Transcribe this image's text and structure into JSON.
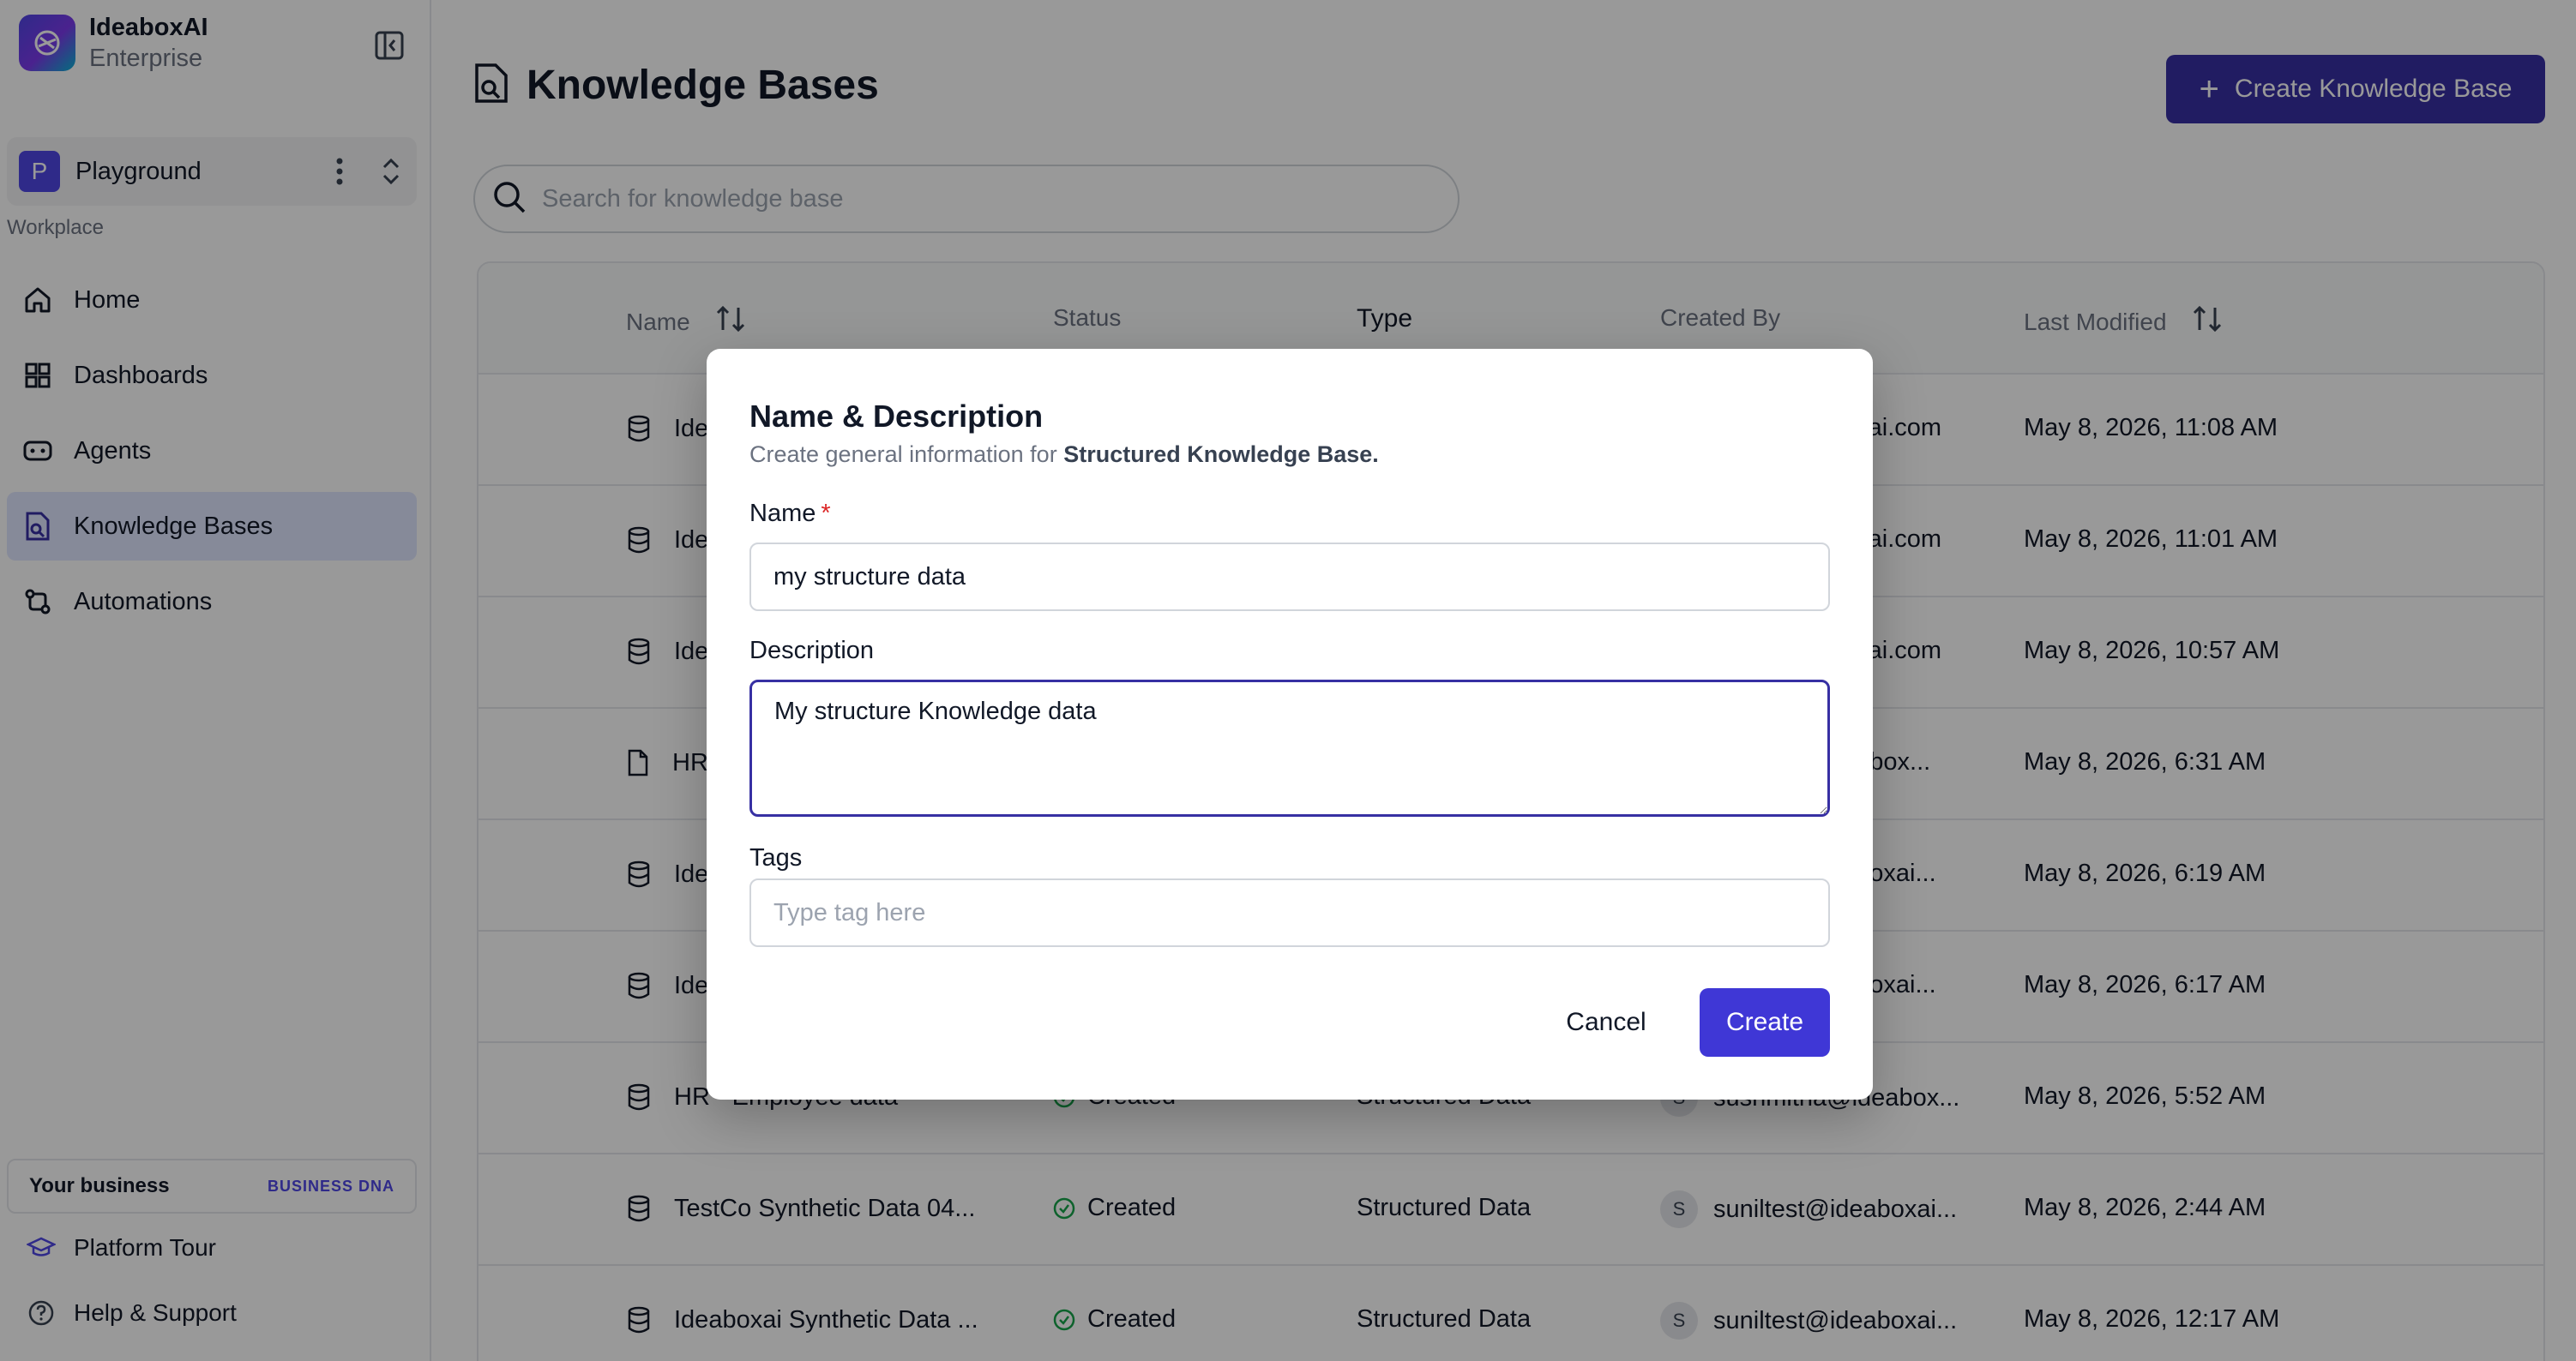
{
  "brand": {
    "name": "IdeaboxAI",
    "plan": "Enterprise"
  },
  "workspace": {
    "initial": "P",
    "name": "Playground",
    "label": "Workplace"
  },
  "nav": [
    {
      "label": "Home",
      "icon": "home-icon"
    },
    {
      "label": "Dashboards",
      "icon": "grid-icon"
    },
    {
      "label": "Agents",
      "icon": "agent-icon"
    },
    {
      "label": "Knowledge Bases",
      "icon": "knowledge-icon",
      "active": true
    },
    {
      "label": "Automations",
      "icon": "workflow-icon"
    }
  ],
  "business": {
    "title": "Your business",
    "tag": "BUSINESS DNA"
  },
  "footer": {
    "tour": "Platform Tour",
    "help": "Help & Support"
  },
  "page": {
    "title": "Knowledge Bases",
    "create_button": "Create Knowledge Base"
  },
  "search": {
    "placeholder": "Search for knowledge base"
  },
  "table": {
    "columns": {
      "name": "Name",
      "status": "Status",
      "type": "Type",
      "created_by": "Created By",
      "last_modified": "Last Modified"
    },
    "rows": [
      {
        "icon": "database-icon",
        "name": "Ide",
        "status": "",
        "type": "",
        "user_initial": "",
        "created_by": "oxai.com",
        "modified": "May 8, 2026, 11:08 AM"
      },
      {
        "icon": "database-icon",
        "name": "Ide",
        "status": "",
        "type": "",
        "user_initial": "",
        "created_by": "oxai.com",
        "modified": "May 8, 2026, 11:01 AM"
      },
      {
        "icon": "database-icon",
        "name": "Ide",
        "status": "",
        "type": "",
        "user_initial": "",
        "created_by": "oxai.com",
        "modified": "May 8, 2026, 10:57 AM"
      },
      {
        "icon": "file-icon",
        "name": "HR",
        "status": "",
        "type": "",
        "user_initial": "",
        "created_by": "eabox...",
        "modified": "May 8, 2026, 6:31 AM"
      },
      {
        "icon": "database-icon",
        "name": "Ide",
        "status": "",
        "type": "",
        "user_initial": "",
        "created_by": "aboxai...",
        "modified": "May 8, 2026, 6:19 AM"
      },
      {
        "icon": "database-icon",
        "name": "Ide",
        "status": "",
        "type": "",
        "user_initial": "",
        "created_by": "aboxai...",
        "modified": "May 8, 2026, 6:17 AM"
      },
      {
        "icon": "database-icon",
        "name": "HR - Employee data",
        "status": "Created",
        "type": "Structured Data",
        "user_initial": "S",
        "created_by": "sushmitha@ideabox...",
        "modified": "May 8, 2026, 5:52 AM"
      },
      {
        "icon": "database-icon",
        "name": "TestCo Synthetic Data 04...",
        "status": "Created",
        "type": "Structured Data",
        "user_initial": "S",
        "created_by": "suniltest@ideaboxai...",
        "modified": "May 8, 2026, 2:44 AM"
      },
      {
        "icon": "database-icon",
        "name": "Ideaboxai Synthetic Data ...",
        "status": "Created",
        "type": "Structured Data",
        "user_initial": "S",
        "created_by": "suniltest@ideaboxai...",
        "modified": "May 8, 2026, 12:17 AM"
      }
    ]
  },
  "modal": {
    "title": "Name & Description",
    "subtitle_prefix": "Create general information for ",
    "subtitle_bold": "Structured Knowledge Base.",
    "name_label": "Name",
    "required_mark": "*",
    "name_value": "my structure data",
    "description_label": "Description",
    "description_value": "My structure Knowledge data",
    "tags_label": "Tags",
    "tags_placeholder": "Type tag here",
    "cancel_label": "Cancel",
    "create_label": "Create"
  },
  "colors": {
    "accent": "#3f37d6",
    "overlay": "rgba(0,0,0,0.40)",
    "status_ok": "#16a34a"
  }
}
